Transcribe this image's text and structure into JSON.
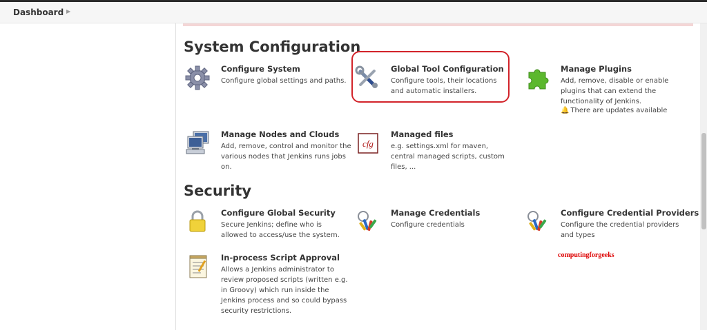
{
  "breadcrumb": {
    "items": [
      "Dashboard"
    ]
  },
  "sections": {
    "system": {
      "title": "System Configuration",
      "items": [
        {
          "title": "Configure System",
          "desc": "Configure global settings and paths.",
          "icon": "gear-icon"
        },
        {
          "title": "Global Tool Configuration",
          "desc": "Configure tools, their locations and automatic installers.",
          "icon": "tools-icon"
        },
        {
          "title": "Manage Plugins",
          "desc": "Add, remove, disable or enable plugins that can extend the functionality of Jenkins.",
          "icon": "puzzle-icon",
          "notice": "There are updates available"
        },
        {
          "title": "Manage Nodes and Clouds",
          "desc": "Add, remove, control and monitor the various nodes that Jenkins runs jobs on.",
          "icon": "computer-icon"
        },
        {
          "title": "Managed files",
          "desc": "e.g. settings.xml for maven, central managed scripts, custom files, ...",
          "icon": "cfg-icon",
          "icon_text": "cfg"
        }
      ]
    },
    "security": {
      "title": "Security",
      "items": [
        {
          "title": "Configure Global Security",
          "desc": "Secure Jenkins; define who is allowed to access/use the system.",
          "icon": "lock-icon"
        },
        {
          "title": "Manage Credentials",
          "desc": "Configure credentials",
          "icon": "keys-icon"
        },
        {
          "title": "Configure Credential Providers",
          "desc": "Configure the credential providers and types",
          "icon": "keys-icon"
        },
        {
          "title": "In-process Script Approval",
          "desc": "Allows a Jenkins administrator to review proposed scripts (written e.g. in Groovy) which run inside the Jenkins process and so could bypass security restrictions.",
          "icon": "notepad-icon"
        }
      ]
    }
  },
  "watermark": "computingforgeeks",
  "colors": {
    "highlight": "#d2232a",
    "notice": "#dd0000",
    "puzzle": "#5cb82e"
  }
}
